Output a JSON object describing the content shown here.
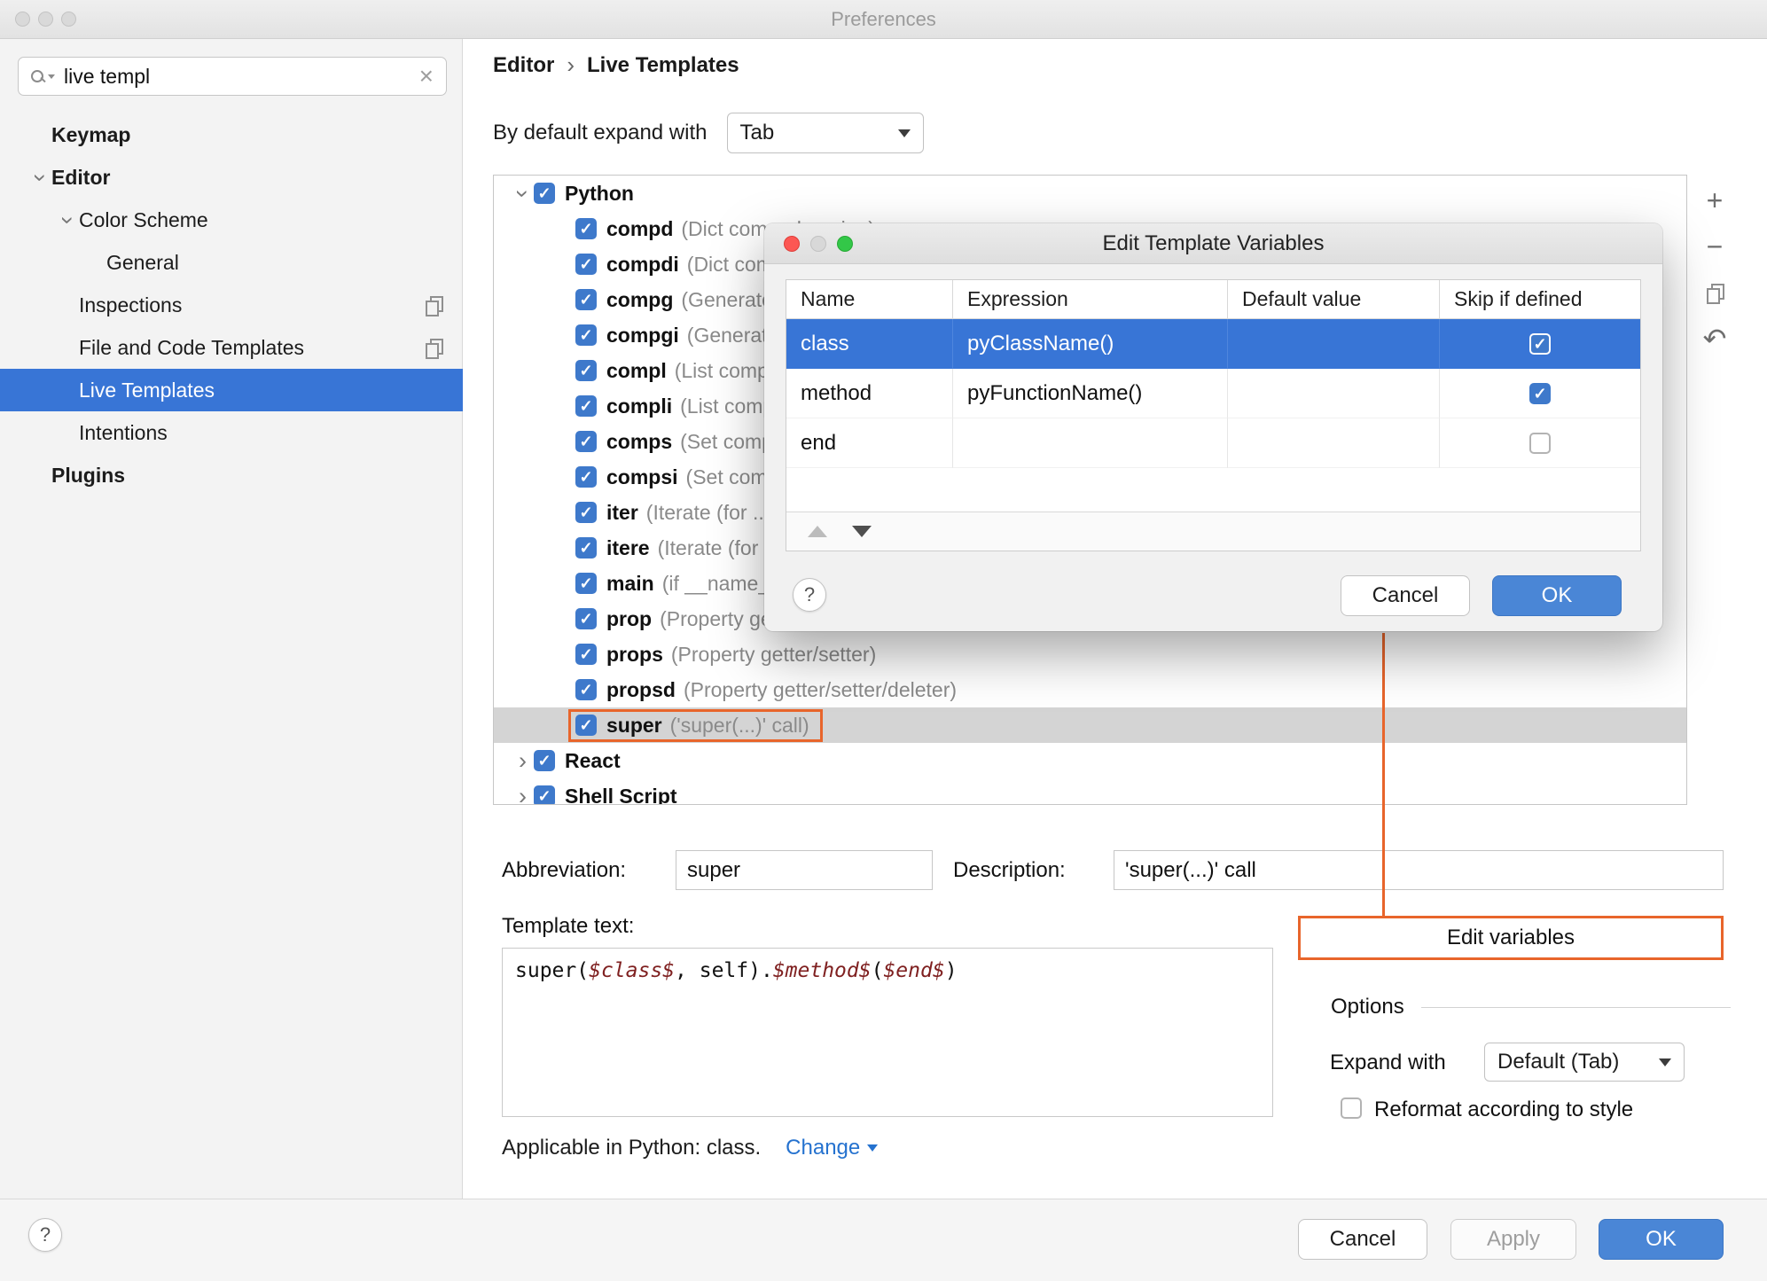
{
  "window": {
    "title": "Preferences"
  },
  "sidebar": {
    "search": {
      "value": "live templ"
    },
    "items": [
      {
        "label": "Keymap",
        "bold": true,
        "indent": 0
      },
      {
        "label": "Editor",
        "bold": true,
        "indent": 0,
        "chevron": "down"
      },
      {
        "label": "Color Scheme",
        "indent": 1,
        "chevron": "down"
      },
      {
        "label": "General",
        "indent": 2
      },
      {
        "label": "Inspections",
        "indent": 1,
        "copy_icon": true
      },
      {
        "label": "File and Code Templates",
        "indent": 1,
        "copy_icon": true
      },
      {
        "label": "Live Templates",
        "indent": 1,
        "selected": true
      },
      {
        "label": "Intentions",
        "indent": 1
      },
      {
        "label": "Plugins",
        "bold": true,
        "indent": 0
      }
    ]
  },
  "header": {
    "breadcrumb": [
      "Editor",
      "Live Templates"
    ],
    "separator": "›",
    "expand_with_label": "By default expand with",
    "expand_with_value": "Tab"
  },
  "template_tree": {
    "rows": [
      {
        "type": "group",
        "name": "Python",
        "expanded": true,
        "checked": true
      },
      {
        "type": "item",
        "name": "compd",
        "desc": "(Dict comprehension)"
      },
      {
        "type": "item",
        "name": "compdi",
        "desc": "(Dict comprehension with if)"
      },
      {
        "type": "item",
        "name": "compg",
        "desc": "(Generator comprehension)"
      },
      {
        "type": "item",
        "name": "compgi",
        "desc": "(Generator comprehension with if)"
      },
      {
        "type": "item",
        "name": "compl",
        "desc": "(List comprehension)"
      },
      {
        "type": "item",
        "name": "compli",
        "desc": "(List comprehension with if)"
      },
      {
        "type": "item",
        "name": "comps",
        "desc": "(Set comprehension)"
      },
      {
        "type": "item",
        "name": "compsi",
        "desc": "(Set comprehension with if)"
      },
      {
        "type": "item",
        "name": "iter",
        "desc": "(Iterate (for ... in ...))"
      },
      {
        "type": "item",
        "name": "itere",
        "desc": "(Iterate (for ... in enumerate))"
      },
      {
        "type": "item",
        "name": "main",
        "desc": "(if __name__ == '__main__')"
      },
      {
        "type": "item",
        "name": "prop",
        "desc": "(Property getter)"
      },
      {
        "type": "item",
        "name": "props",
        "desc": "(Property getter/setter)"
      },
      {
        "type": "item",
        "name": "propsd",
        "desc": "(Property getter/setter/deleter)"
      },
      {
        "type": "item",
        "name": "super",
        "desc": "('super(...)' call)",
        "selected": true,
        "highlighted": true
      },
      {
        "type": "group",
        "name": "React",
        "expanded": false,
        "checked": true
      },
      {
        "type": "group",
        "name": "Shell Script",
        "expanded": false,
        "checked": true
      }
    ],
    "toolbar_icons": [
      "add",
      "remove",
      "duplicate",
      "revert"
    ]
  },
  "dialog": {
    "title": "Edit Template Variables",
    "help_label": "?",
    "table": {
      "headers": [
        "Name",
        "Expression",
        "Default value",
        "Skip if defined"
      ],
      "rows": [
        {
          "name": "class",
          "expression": "pyClassName()",
          "default_value": "",
          "skip_if_defined": true,
          "selected": true
        },
        {
          "name": "method",
          "expression": "pyFunctionName()",
          "default_value": "",
          "skip_if_defined": true,
          "selected": false
        },
        {
          "name": "end",
          "expression": "",
          "default_value": "",
          "skip_if_defined": false,
          "selected": false
        }
      ]
    },
    "cancel_label": "Cancel",
    "ok_label": "OK"
  },
  "form": {
    "abbreviation_label": "Abbreviation:",
    "abbreviation_value": "super",
    "description_label": "Description:",
    "description_value": "'super(...)' call",
    "template_text_label": "Template text:",
    "template_text_parts": [
      {
        "text": "super(",
        "variable": false
      },
      {
        "text": "$class$",
        "variable": true
      },
      {
        "text": ", self).",
        "variable": false
      },
      {
        "text": "$method$",
        "variable": true
      },
      {
        "text": "(",
        "variable": false
      },
      {
        "text": "$end$",
        "variable": true
      },
      {
        "text": ")",
        "variable": false
      }
    ],
    "applicable_label": "Applicable in Python: class.",
    "change_link": "Change",
    "edit_variables_label": "Edit variables",
    "options_label": "Options",
    "expand_with_label": "Expand with",
    "expand_with_value": "Default (Tab)",
    "reformat_label": "Reformat according to style",
    "reformat_checked": false
  },
  "footer": {
    "help_label": "?",
    "cancel_label": "Cancel",
    "apply_label": "Apply",
    "ok_label": "OK"
  },
  "colors": {
    "selection_blue": "#3875d6",
    "checkbox_blue": "#3e79cb",
    "highlight_orange": "#e8652b",
    "link_blue": "#2572cf",
    "ok_button_blue": "#4a86d6",
    "variable_red": "#7f2020"
  }
}
